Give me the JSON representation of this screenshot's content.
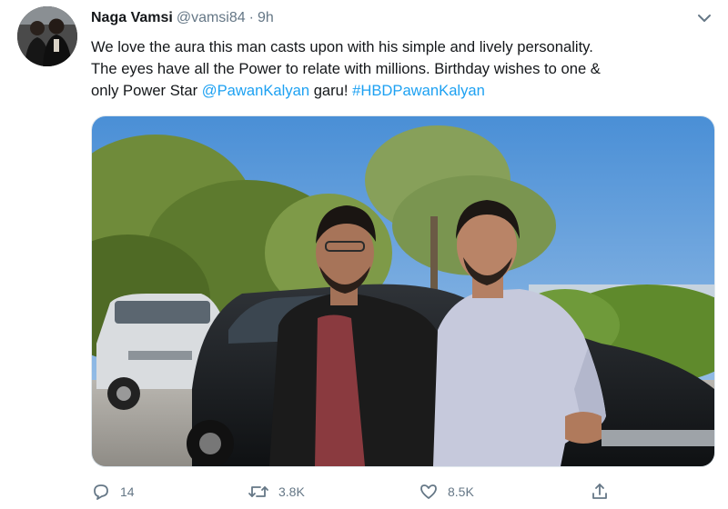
{
  "tweet": {
    "author_name": "Naga Vamsi",
    "author_handle": "@vamsi84",
    "separator": "·",
    "time": "9h",
    "text_line1": "We love the aura this man casts upon with his simple and lively personality.",
    "text_line2": "The eyes have all the Power to relate with millions. Birthday wishes to one &",
    "text_line3_prefix": "only Power Star ",
    "mention": "@PawanKalyan",
    "text_line3_middle": " garu! ",
    "hashtag": "#HBDPawanKalyan"
  },
  "actions": {
    "reply": {
      "icon": "reply-icon",
      "count": "14"
    },
    "retweet": {
      "icon": "retweet-icon",
      "count": "3.8K"
    },
    "like": {
      "icon": "heart-icon",
      "count": "8.5K"
    },
    "share": {
      "icon": "share-icon"
    }
  },
  "colors": {
    "link": "#1da1f2",
    "secondary_text": "#657786",
    "primary_text": "#14171a"
  }
}
